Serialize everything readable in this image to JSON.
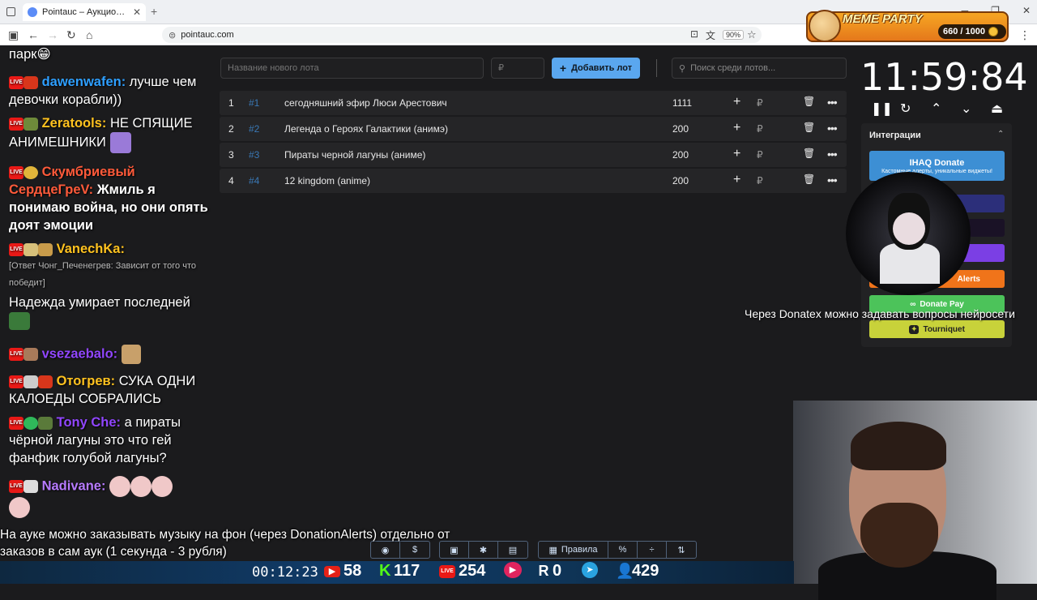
{
  "browser": {
    "tab_title": "Pointauc – Аукционы, лотереи",
    "url": "pointauc.com",
    "zoom": "90%"
  },
  "meme_party": {
    "title": "MEME PARTY",
    "progress": "660 / 1000"
  },
  "chat": [
    {
      "user": "",
      "text": "парк😁",
      "color": "#ffffff"
    },
    {
      "user": "dawenwafen:",
      "text": " лучше чем девочки корабли))",
      "color": "#2e9fff"
    },
    {
      "user": "Zeratools:",
      "text": " НЕ СПЯЩИЕ АНИМЕШНИКИ",
      "color": "#ffc21f"
    },
    {
      "user": "Скумбриевый",
      "text": "",
      "color": "#ff5a3a"
    },
    {
      "user": "СердцеГреV:",
      "text": " Жмиль я понимаю война, но они опять доят эмоции",
      "color": "#ff5a3a"
    },
    {
      "user": "VanechKa:",
      "text": "",
      "color": "#ffc21f"
    },
    {
      "user": "",
      "text": "[Ответ Чонг_Печенегрев: Зависит от того что победит]",
      "color": "#bbbbbb"
    },
    {
      "user": "",
      "text": "Надежда умирает последней",
      "color": "#ffffff"
    },
    {
      "user": "vsezaebalo:",
      "text": "",
      "color": "#9146ff"
    },
    {
      "user": "Отогрев:",
      "text": " СУКА ОДНИ КАЛОЕДЫ СОБРАЛИСЬ",
      "color": "#ffc21f"
    },
    {
      "user": "Tony Che:",
      "text": " а пираты чёрной лагуны это что гей фанфик голубой лагуны?",
      "color": "#9146ff"
    },
    {
      "user": "Nadivane:",
      "text": "",
      "color": "#b77bff"
    }
  ],
  "toolbar": {
    "lot_name_placeholder": "Название нового лота",
    "amount_placeholder": "₽",
    "add_lot_label": "Добавить лот",
    "search_placeholder": "Поиск среди лотов..."
  },
  "lots": [
    {
      "num": "1",
      "id": "#1",
      "name": "сегодняшний эфир Люси Арестович",
      "amount": "1111"
    },
    {
      "num": "2",
      "id": "#2",
      "name": "Легенда о Героях Галактики (анимэ)",
      "amount": "200"
    },
    {
      "num": "3",
      "id": "#3",
      "name": "Пираты черной лагуны (аниме)",
      "amount": "200"
    },
    {
      "num": "4",
      "id": "#4",
      "name": "12 kingdom (anime)",
      "amount": "200"
    }
  ],
  "currency_symbol": "₽",
  "timer": "11:59:84",
  "integrations": {
    "title": "Интеграции",
    "ihaq_label": "IHAQ Donate",
    "ihaq_sub": "Кастомные алерты, уникальные виджеты!",
    "donatepay_label": "Donate Pay",
    "alerts_label": "Alerts",
    "tourniquet_label": "Tourniquet",
    "colors": {
      "ihaq": "#3d8fd4",
      "blue": "#2c2f7a",
      "dark": "#1a1226",
      "purple": "#7b3fe4",
      "alerts": "#f0741a",
      "donatepay": "#4cc35a",
      "tourniquet": "#c8d23a"
    }
  },
  "donatex_text": "Через Donatex можно задавать вопросы нейросети",
  "subtitle": "На ауке можно заказывать музыку на фон (через DonationAlerts) отдельно от заказов в сам аук (1 секунда - 3 рубля)",
  "bottom_toolbar": {
    "rules_label": "Правила",
    "dollar": "$",
    "percent": "%"
  },
  "stats": {
    "uptime": "00:12:23",
    "youtube": "58",
    "kick": "117",
    "vk": "254",
    "rutube": "0",
    "viewers": "429"
  }
}
